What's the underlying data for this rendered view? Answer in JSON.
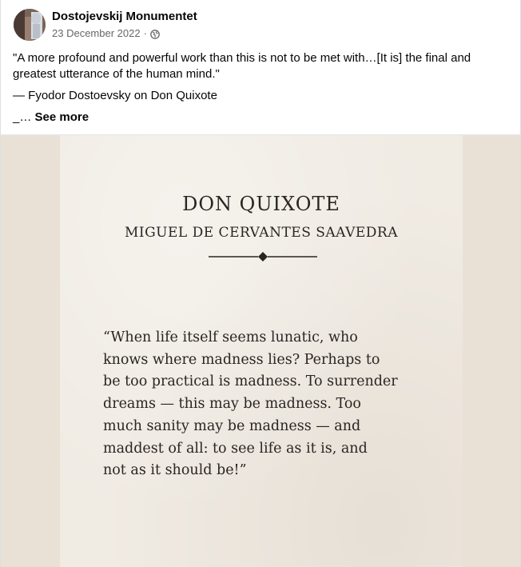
{
  "post": {
    "author": "Dostojevskij Monumentet",
    "date": "23 December 2022",
    "separator": "·",
    "privacy_icon": "globe-icon",
    "text_paragraphs": [
      "\"A more profound and powerful work than this is not to be met with…[It is] the final and greatest utterance of the human mind.\"",
      "— Fyodor Dostoevsky on Don Quixote"
    ],
    "truncated_prefix": "_…",
    "see_more_label": "See more"
  },
  "image": {
    "book_title": "DON QUIXOTE",
    "book_author": "MIGUEL DE CERVANTES SAAVEDRA",
    "quote": "“When life itself seems lunatic, who\nknows where madness lies? Perhaps to\nbe too practical is madness. To surrender\ndreams — this may be madness. Too\nmuch sanity may be madness — and\nmaddest of all: to see life as it is, and\nnot as it should be!”"
  },
  "colors": {
    "name_text": "#050505",
    "meta_text": "#65676b",
    "image_background": "#e9e1d6",
    "card_background": "#f0ebe3",
    "card_ink": "#2a2522"
  }
}
